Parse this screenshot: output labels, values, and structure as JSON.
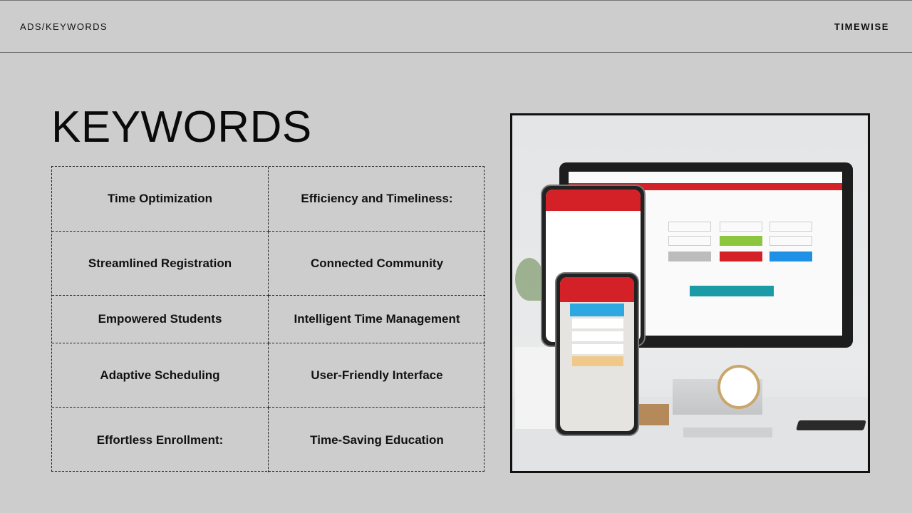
{
  "header": {
    "breadcrumb": "ADS/KEYWORDS",
    "brand": "TIMEWISE"
  },
  "title": "KEYWORDS",
  "keywords": [
    "Time Optimization",
    "Efficiency and Timeliness:",
    "Streamlined Registration",
    "Connected Community",
    "Empowered Students",
    "Intelligent Time Management",
    "Adaptive Scheduling",
    "User-Friendly Interface",
    "Effortless Enrollment:",
    "Time-Saving Education"
  ],
  "illustration": {
    "description_icon": "devices-mockup-image",
    "colors": {
      "accent_red": "#d42127",
      "green": "#8cc63f",
      "blue": "#1e90e6",
      "teal": "#1a9ba6"
    }
  }
}
